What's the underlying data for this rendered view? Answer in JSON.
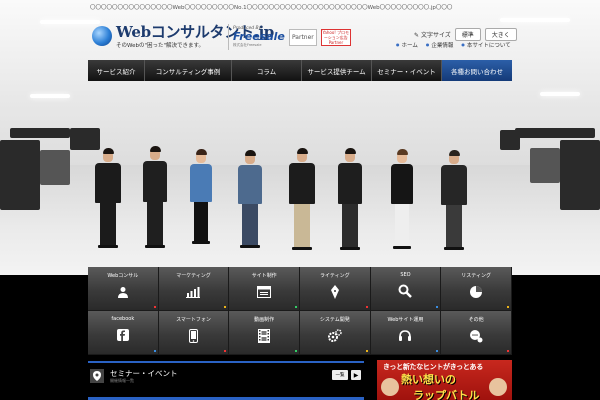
{
  "top_strip": {
    "text": "〇〇〇〇〇〇〇〇〇〇〇〇〇〇〇Web〇〇〇〇〇〇〇〇〇No.1〇〇〇〇〇〇〇〇〇〇〇〇〇〇〇〇〇〇〇〇〇〇Web〇〇〇〇〇〇〇〇〇.jp〇〇〇"
  },
  "logo": {
    "main": "Webコンサルタント.jp",
    "sub": "そのWebの\"困った\"解決できます。"
  },
  "partners": {
    "freesale_produced": "Produced By",
    "freesale_name": "Freesale",
    "freesale_tag": "株式会社Freesale",
    "partner_badge": "Partner",
    "yahoo_badge": "Yahoo! プロモーション広告 Partner"
  },
  "font_size": {
    "label": "文字サイズ",
    "standard": "標準",
    "large": "大きく"
  },
  "top_links": [
    "ホーム",
    "企業情報",
    "本サイトについて"
  ],
  "nav": {
    "items": [
      "サービス紹介",
      "コンサルティング事例",
      "コラム",
      "サービス提供チーム",
      "セミナー・イベント"
    ],
    "contact": "各種お問い合わせ"
  },
  "services": [
    {
      "label": "Webコンサル",
      "icon": "person-icon"
    },
    {
      "label": "マーケティング",
      "icon": "bar-chart-icon"
    },
    {
      "label": "サイト制作",
      "icon": "window-icon"
    },
    {
      "label": "ライティング",
      "icon": "pen-icon"
    },
    {
      "label": "SEO",
      "icon": "magnifier-icon"
    },
    {
      "label": "リスティング",
      "icon": "pie-chart-icon"
    },
    {
      "label": "facebook",
      "icon": "facebook-icon"
    },
    {
      "label": "スマートフォン",
      "icon": "smartphone-icon"
    },
    {
      "label": "動画制作",
      "icon": "film-icon"
    },
    {
      "label": "システム開発",
      "icon": "gears-icon"
    },
    {
      "label": "Webサイト運用",
      "icon": "headset-icon"
    },
    {
      "label": "その他",
      "icon": "bubbles-icon"
    }
  ],
  "seminar": {
    "title": "セミナー・イベント",
    "subtitle": "開催情報一覧",
    "list_button": "一覧",
    "next_button": "▶"
  },
  "banner": {
    "line1": "きっと新たなヒントがきっとある",
    "line2": "熱い想いの",
    "line3": "ラップバトル"
  },
  "colors": {
    "accent_blue": "#2a62c4",
    "nav_dark": "#111111",
    "contact_blue": "#143a78",
    "banner_red": "#b01a14"
  }
}
